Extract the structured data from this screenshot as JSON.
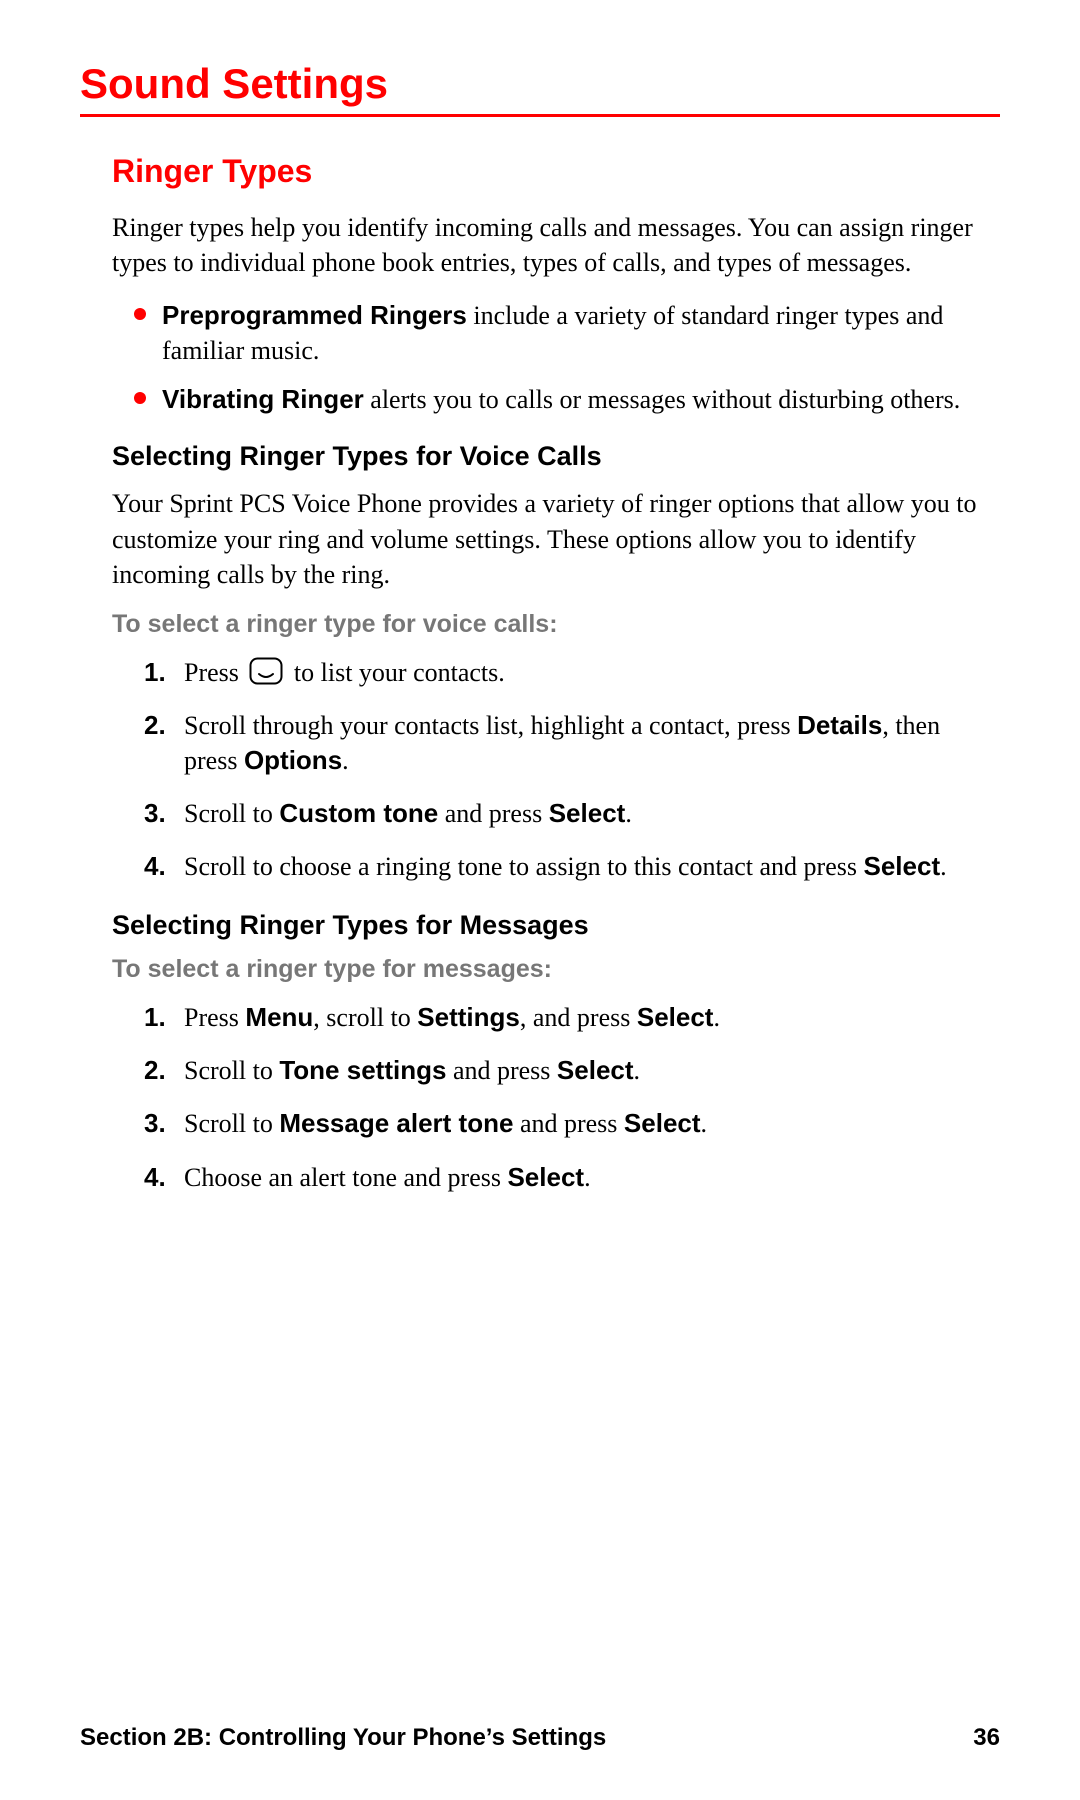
{
  "page": {
    "title": "Sound Settings"
  },
  "ringer_types": {
    "heading": "Ringer Types",
    "intro": "Ringer types help you identify incoming calls and messages. You can assign ringer types to individual phone book entries, types of calls, and types of messages.",
    "bullets": [
      {
        "term": "Preprogrammed Ringers",
        "rest": " include a variety of standard ringer types and familiar music."
      },
      {
        "term": "Vibrating Ringer",
        "rest": " alerts you to calls or messages without disturbing others."
      }
    ]
  },
  "voice_calls": {
    "heading": "Selecting Ringer Types for Voice Calls",
    "intro": "Your Sprint PCS Voice Phone provides a variety of ringer options that allow you to customize your ring and volume settings. These options allow you to identify incoming calls by the ring.",
    "lead_in": "To select a ringer type for voice calls:",
    "steps": {
      "s1_a": "Press ",
      "s1_b": " to list your contacts.",
      "s2_a": "Scroll through your contacts list, highlight a contact, press ",
      "s2_b1": "Details",
      "s2_c": ", then press ",
      "s2_b2": "Options",
      "s2_d": ".",
      "s3_a": "Scroll to ",
      "s3_b1": "Custom tone",
      "s3_c": " and press ",
      "s3_b2": "Select",
      "s3_d": ".",
      "s4_a": "Scroll to choose a ringing tone to assign to this contact and press ",
      "s4_b": "Select",
      "s4_c": "."
    }
  },
  "messages": {
    "heading": "Selecting Ringer Types for Messages",
    "lead_in": "To select a ringer type for messages:",
    "steps": {
      "s1_a": "Press ",
      "s1_b1": "Menu",
      "s1_c": ", scroll to ",
      "s1_b2": "Settings",
      "s1_d": ", and press ",
      "s1_b3": "Select",
      "s1_e": ".",
      "s2_a": "Scroll to ",
      "s2_b1": "Tone settings",
      "s2_c": " and press ",
      "s2_b2": "Select",
      "s2_d": ".",
      "s3_a": "Scroll to ",
      "s3_b1": "Message alert tone",
      "s3_c": " and press ",
      "s3_b2": "Select",
      "s3_d": ".",
      "s4_a": "Choose an alert tone and press ",
      "s4_b": "Select",
      "s4_c": "."
    }
  },
  "nums": {
    "n1": "1.",
    "n2": "2.",
    "n3": "3.",
    "n4": "4."
  },
  "footer": {
    "section": "Section 2B: Controlling Your Phone’s Settings",
    "page_number": "36"
  }
}
